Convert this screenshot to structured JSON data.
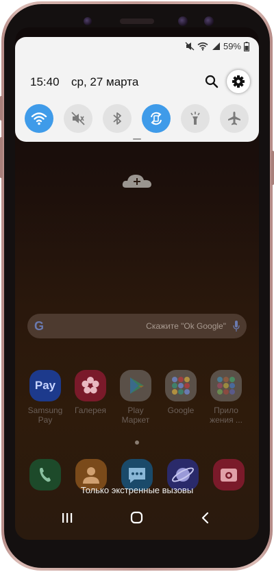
{
  "status_bar": {
    "battery": "59%"
  },
  "quick_panel": {
    "time": "15:40",
    "date": "ср, 27 марта",
    "toggles": [
      {
        "name": "wifi",
        "on": true
      },
      {
        "name": "sound-mute",
        "on": false
      },
      {
        "name": "bluetooth",
        "on": false
      },
      {
        "name": "auto-rotate",
        "on": true
      },
      {
        "name": "flashlight",
        "on": false
      },
      {
        "name": "airplane-mode",
        "on": false
      }
    ]
  },
  "home": {
    "search_hint": "Скажите \"Ok Google\"",
    "apps": [
      {
        "icon_text": "Pay",
        "label": "Samsung Pay"
      },
      {
        "label": "Галерея"
      },
      {
        "label": "Play Маркет"
      },
      {
        "label": "Google"
      },
      {
        "label": "Прило жения ..."
      }
    ],
    "emergency_text": "Только экстренные вызовы"
  },
  "colors": {
    "toggle_on": "#3f9be9",
    "panel_bg": "#f3f3f3"
  }
}
